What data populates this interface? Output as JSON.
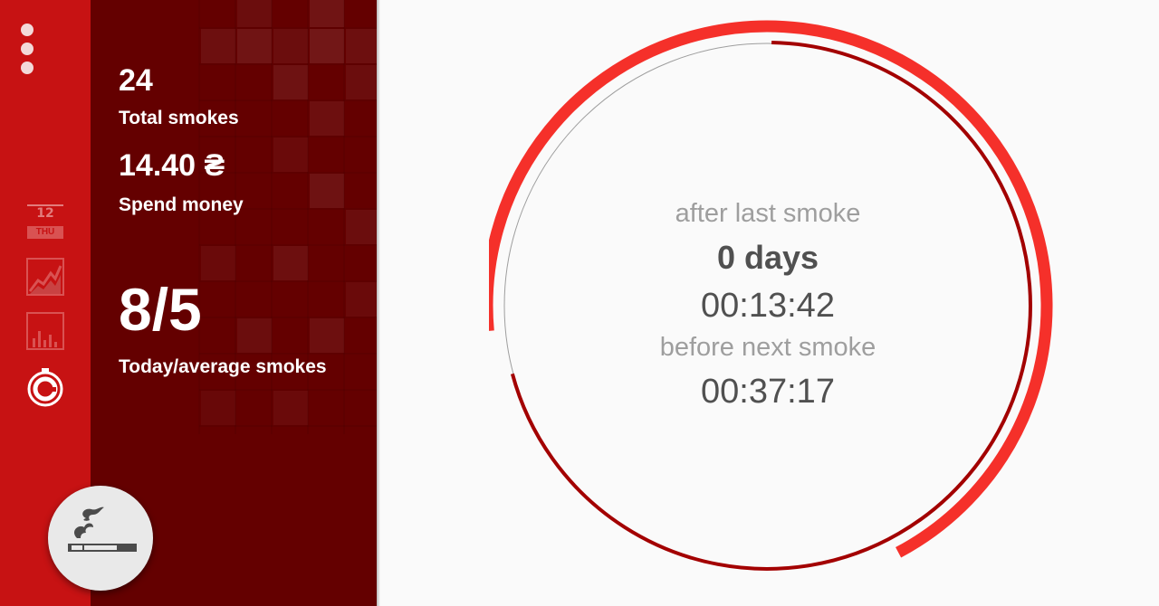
{
  "nav": {
    "calendar_date": "12",
    "calendar_day": "THU"
  },
  "stats": {
    "total_smokes_value": "24",
    "total_smokes_label": "Total smokes",
    "spend_money_value": "14.40 ₴",
    "spend_money_label": "Spend money",
    "today_average_value": "8/5",
    "today_average_label": "Today/average smokes"
  },
  "timer": {
    "after_label": "after last smoke",
    "days": "0 days",
    "elapsed": "00:13:42",
    "before_label": "before next smoke",
    "remaining": "00:37:17",
    "progress_fraction": 0.27
  },
  "colors": {
    "rail": "#c71213",
    "panel": "#640000",
    "accent": "#f5302a",
    "dark_arc": "#a30000"
  },
  "icons": {
    "menu": "more-vert-icon",
    "calendar": "calendar-icon",
    "trend": "line-chart-icon",
    "bars": "bar-chart-icon",
    "timer": "timer-icon",
    "smoke": "cigarette-icon"
  }
}
